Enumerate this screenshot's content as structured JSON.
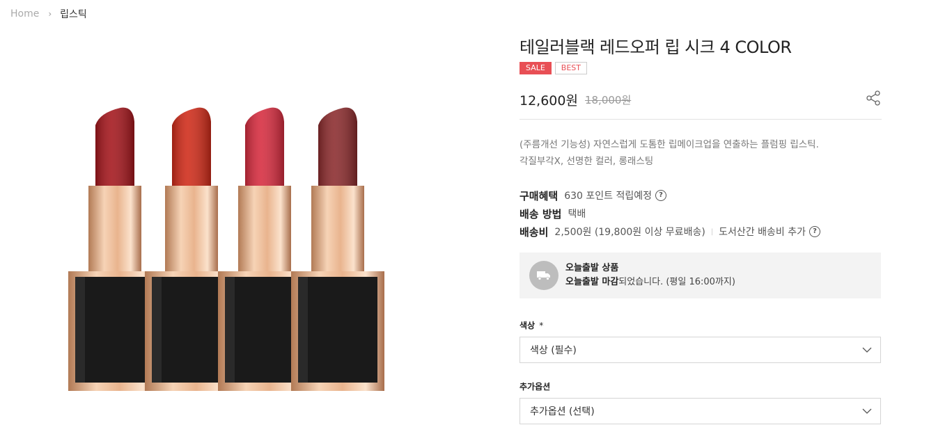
{
  "breadcrumb": {
    "home": "Home",
    "current": "립스틱"
  },
  "product": {
    "title": "테일러블랙 레드오퍼 립 시크 4 COLOR",
    "badges": {
      "sale": "SALE",
      "best": "BEST"
    },
    "price": "12,600원",
    "original_price": "18,000원",
    "description_line1": "(주름개선 기능성) 자연스럽게 도톰한 립메이크업을 연출하는 플럼핑 립스틱.",
    "description_line2": "각질부각X, 선명한 컬러, 롱래스팅"
  },
  "meta": {
    "points_label": "구매혜택",
    "points_value": "630 포인트 적립예정",
    "shipping_method_label": "배송 방법",
    "shipping_method_value": "택배",
    "shipping_fee_label": "배송비",
    "shipping_fee_value": "2,500원 (19,800원 이상 무료배송)",
    "shipping_fee_extra": "도서산간 배송비 추가"
  },
  "today_shipping": {
    "title": "오늘출발 상품",
    "status_bold": "오늘출발 마감",
    "status_rest": "되었습니다. (평일 16:00까지)"
  },
  "options": {
    "color_label": "색상",
    "color_required_mark": "*",
    "color_value": "색상 (필수)",
    "extra_label": "추가옵션",
    "extra_value": "추가옵션 (선택)"
  },
  "lipstick_colors": [
    "#a3151b",
    "#cf2a18",
    "#d62b3e",
    "#8a2a2c"
  ],
  "colors": {
    "sale": "#e84f55",
    "box_bg": "#f3f3f3",
    "truck_circle": "#bdbdbd"
  }
}
